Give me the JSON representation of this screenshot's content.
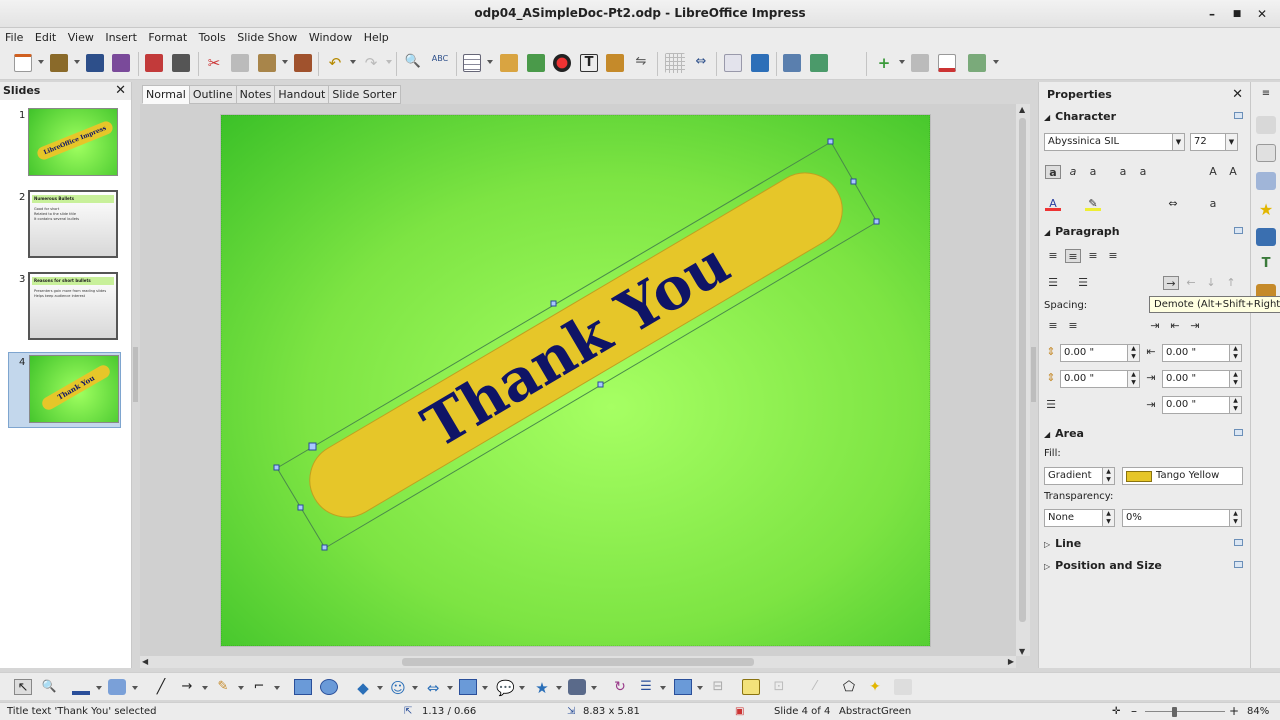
{
  "window": {
    "title": "odp04_ASimpleDoc-Pt2.odp - LibreOffice Impress",
    "minimize_glyph": "–",
    "maximize_glyph": "■",
    "close_glyph": "✕"
  },
  "menu": [
    "File",
    "Edit",
    "View",
    "Insert",
    "Format",
    "Tools",
    "Slide Show",
    "Window",
    "Help"
  ],
  "slides_pane": {
    "title": "Slides",
    "close_glyph": "✕",
    "slides": [
      {
        "num": "1",
        "caption": "LibreOffice Impress",
        "style": "green-banner"
      },
      {
        "num": "2",
        "caption": "Numerous Bullets",
        "style": "white-bullets",
        "bullets": [
          "Good for short",
          "Related to the slide title",
          "It contains several bullets"
        ]
      },
      {
        "num": "3",
        "caption": "Reasons for short bullets",
        "style": "white-bullets",
        "bullets": [
          "Presenters gain more from reading slides",
          "Helps keep audience interest"
        ]
      },
      {
        "num": "4",
        "caption": "Thank You",
        "style": "green-banner",
        "selected": true
      }
    ]
  },
  "view_tabs": [
    "Normal",
    "Outline",
    "Notes",
    "Handout",
    "Slide Sorter"
  ],
  "slide": {
    "text": "Thank You",
    "banner_color": "#E6C629",
    "text_color": "#0F1466",
    "bg_center": "#A6FF63",
    "bg_edge": "#3BC128"
  },
  "properties": {
    "title": "Properties",
    "close_glyph": "✕",
    "character": {
      "header": "Character",
      "font": "Abyssinica SIL",
      "size": "72"
    },
    "paragraph": {
      "header": "Paragraph",
      "spacing_label": "Spacing:",
      "fields": [
        "0.00 \"",
        "0.00 \"",
        "0.00 \"",
        "0.00 \"",
        "0.00 \""
      ]
    },
    "area": {
      "header": "Area",
      "fill_label": "Fill:",
      "fill_type": "Gradient",
      "fill_value": "Tango Yellow",
      "transparency_label": "Transparency:",
      "transparency_type": "None",
      "transparency_value": "0%"
    },
    "line_header": "Line",
    "position_header": "Position and Size"
  },
  "tooltip": "Demote (Alt+Shift+Right)",
  "status": {
    "selection": "Title text 'Thank You' selected",
    "position": "1.13 / 0.66",
    "size": "8.83 x 5.81",
    "slide": "Slide 4 of 4",
    "master": "AbstractGreen",
    "zoom": "84%"
  },
  "colors": {
    "accent_selection": "#C3D7EC",
    "tooltip_bg": "#FFFFE1"
  }
}
